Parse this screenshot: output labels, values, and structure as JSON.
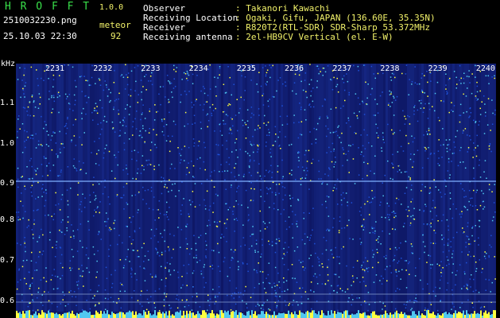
{
  "app": {
    "name": "H R O F F T",
    "version": "1.0.0",
    "filename": "2510032230.png",
    "mode_label": "meteor",
    "datetime": "25.10.03 22:30",
    "count": "92"
  },
  "info": [
    {
      "label": "Observer",
      "value": ": Takanori Kawachi"
    },
    {
      "label": "Receiving Location",
      "value": ": Ogaki, Gifu, JAPAN (136.60E, 35.35N)"
    },
    {
      "label": "Receiver",
      "value": ": R820T2(RTL-SDR) SDR-Sharp 53.372MHz"
    },
    {
      "label": "Receiving antenna",
      "value": ": 2el-HB9CV Vertical (el. E-W)"
    }
  ],
  "axes": {
    "y_unit": "kHz",
    "x_ticks": [
      "2231",
      "2232",
      "2233",
      "2234",
      "2235",
      "2236",
      "2237",
      "2238",
      "2239",
      "2240"
    ],
    "y_ticks": [
      "1.1",
      "1.0",
      "0.9",
      "0.8",
      "0.7",
      "0.6"
    ]
  },
  "colors": {
    "title_green": "#39e04a",
    "value_yellow": "#f2f26a",
    "spectrum_bg": "#0d1560",
    "noise_blue": "#1e50d8",
    "noise_cyan": "#50c8f0",
    "noise_yellow": "#ffff40"
  }
}
